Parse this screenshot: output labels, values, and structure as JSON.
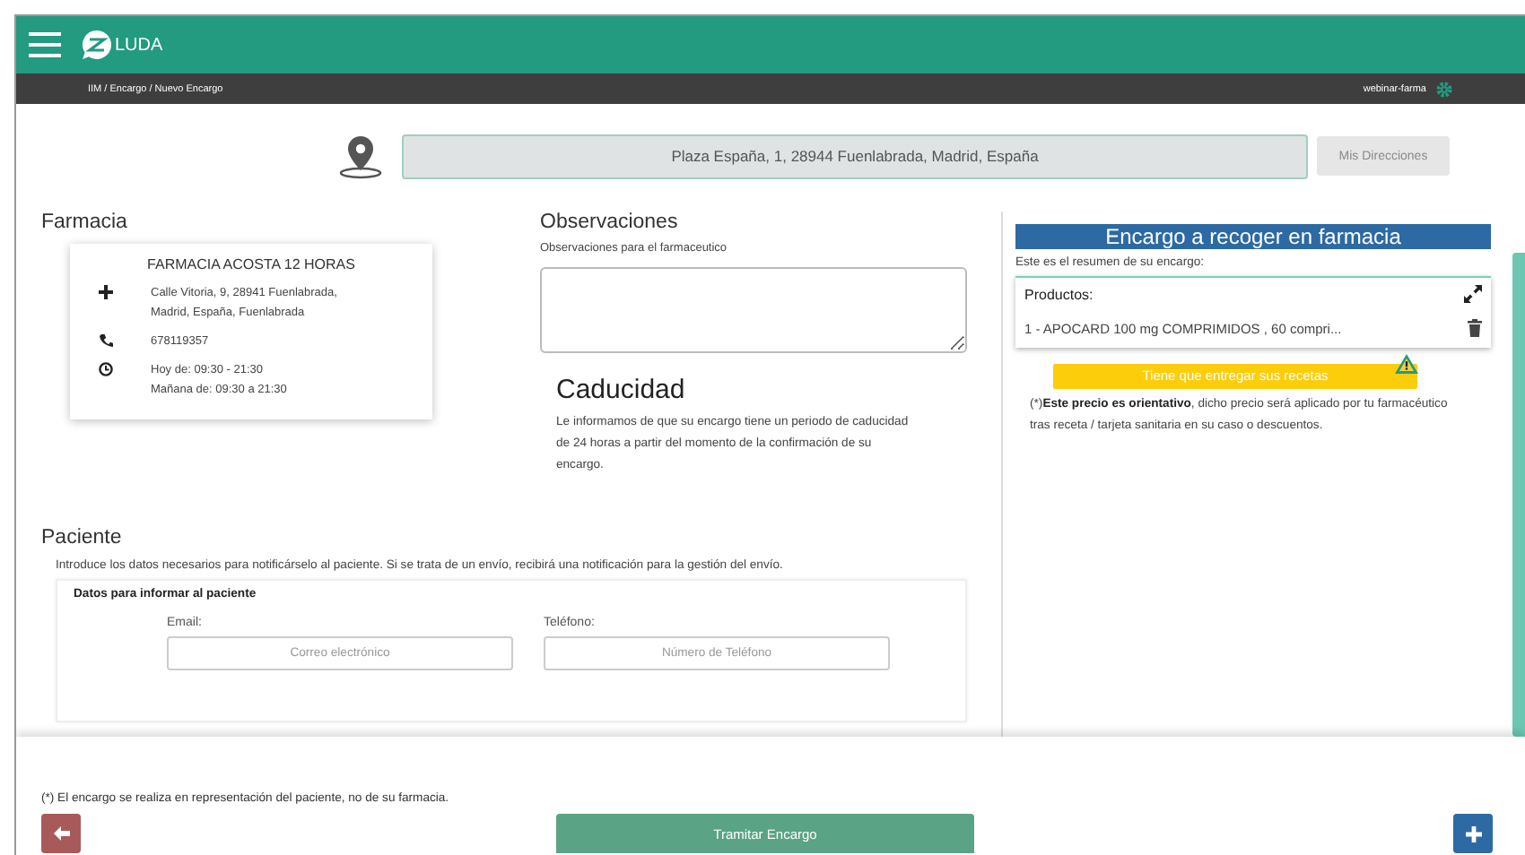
{
  "app_name": "LUDA",
  "breadcrumb": "IIM / Encargo / Nuevo Encargo",
  "user": "webinar-farma",
  "address": {
    "value": "Plaza España, 1, 28944 Fuenlabrada, Madrid, España",
    "button": "Mis Direcciones",
    "button_disabled": true
  },
  "pharmacy": {
    "heading": "Farmacia",
    "name": "FARMACIA ACOSTA 12 HORAS",
    "details": [
      {
        "kind": "address",
        "lines": [
          "Calle Vitoria, 9, 28941 Fuenlabrada,",
          "Madrid, España, Fuenlabrada"
        ]
      },
      {
        "kind": "phone",
        "lines": [
          "678119357"
        ]
      },
      {
        "kind": "hours",
        "lines": [
          "Hoy de: 09:30 - 21:30",
          "Mañana de: 09:30 a 21:30"
        ]
      }
    ]
  },
  "observations": {
    "heading": "Observaciones",
    "label": "Observaciones para el farmaceutico"
  },
  "expiry": {
    "heading": "Caducidad",
    "text": "Le informamos de que su encargo tiene un periodo de caducidad de 24 horas a partir del momento de la confirmación de su encargo."
  },
  "order": {
    "title": "Encargo a recoger en farmacia",
    "subtitle": "Este es el resumen de su encargo:",
    "products_heading": "Productos:",
    "products": [
      {
        "text": "1 - APOCARD 100 mg COMPRIMIDOS , 60 compri..."
      }
    ],
    "warning": "Tiene que entregar sus recetas",
    "note": "(*)**Este precio es orientativo**, dicho precio será aplicado por tu farmacéutico tras receta / tarjeta sanitaria en su caso o descuentos."
  },
  "patient": {
    "heading": "Paciente",
    "intro": "Introduce los datos necesarios para notificárselo al paciente. Si se trata de un envío, recibirá una notificación para la gestión del envío.",
    "card_title": "Datos para informar al paciente",
    "fields": [
      {
        "label": "Email:",
        "placeholder": "Correo electrónico"
      },
      {
        "label": "Teléfono:",
        "placeholder": "Número de Teléfono"
      }
    ]
  },
  "footer": {
    "note": "(*) El encargo se realiza en representación del paciente, no de su farmacia.",
    "submit": "Tramitar Encargo"
  }
}
